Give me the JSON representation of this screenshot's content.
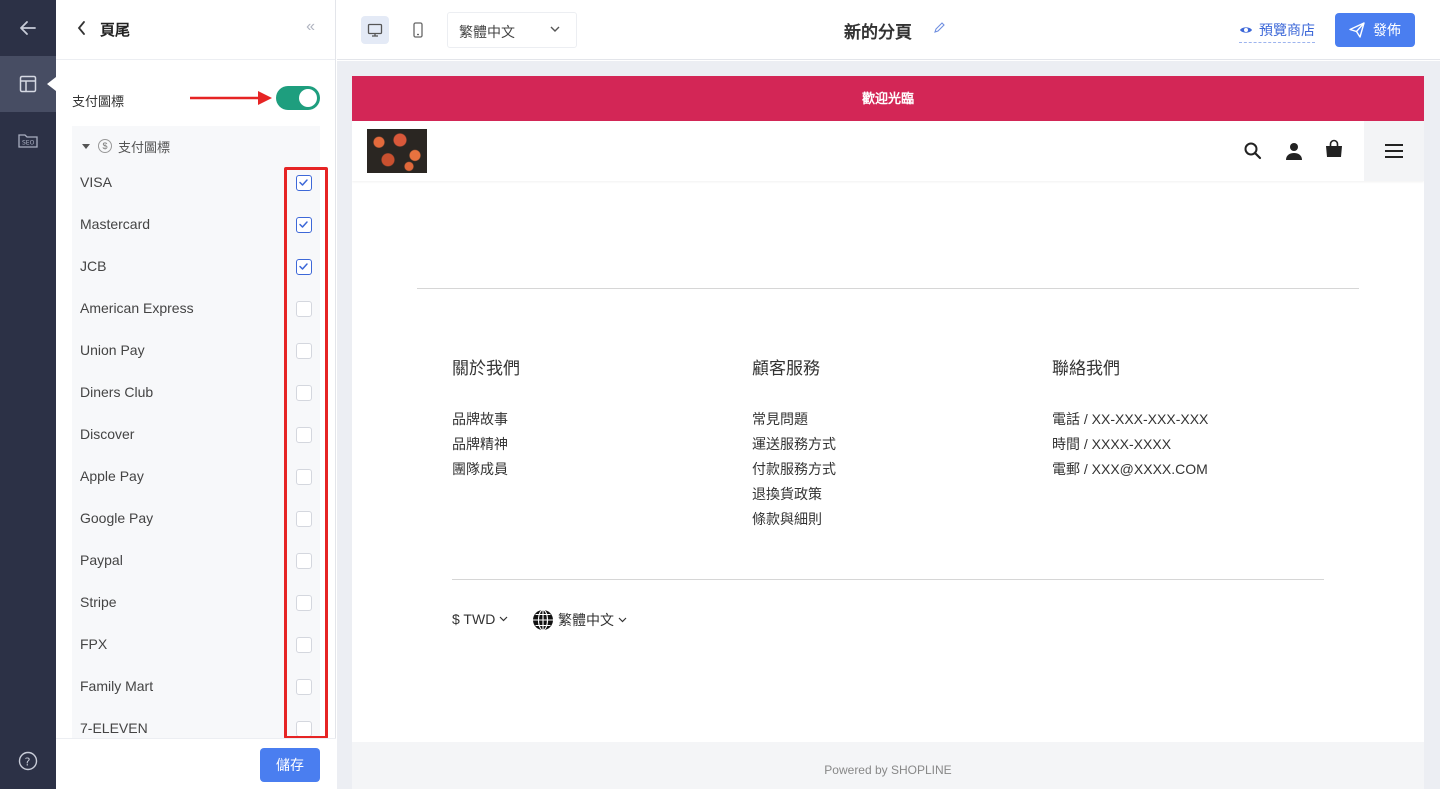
{
  "panel": {
    "title": "頁尾",
    "toggle_label": "支付圖標",
    "toggle_on": true,
    "group_label": "支付圖標",
    "save_label": "儲存",
    "payments": [
      {
        "name": "VISA",
        "checked": true
      },
      {
        "name": "Mastercard",
        "checked": true
      },
      {
        "name": "JCB",
        "checked": true
      },
      {
        "name": "American Express",
        "checked": false
      },
      {
        "name": "Union Pay",
        "checked": false
      },
      {
        "name": "Diners Club",
        "checked": false
      },
      {
        "name": "Discover",
        "checked": false
      },
      {
        "name": "Apple Pay",
        "checked": false
      },
      {
        "name": "Google Pay",
        "checked": false
      },
      {
        "name": "Paypal",
        "checked": false
      },
      {
        "name": "Stripe",
        "checked": false
      },
      {
        "name": "FPX",
        "checked": false
      },
      {
        "name": "Family Mart",
        "checked": false
      },
      {
        "name": "7-ELEVEN",
        "checked": false
      }
    ]
  },
  "topbar": {
    "language": "繁體中文",
    "page_title": "新的分頁",
    "preview_label": "預覽商店",
    "publish_label": "發佈"
  },
  "store": {
    "announcement": "歡迎光臨",
    "footer": {
      "columns": [
        {
          "title": "關於我們",
          "items": [
            "品牌故事",
            "品牌精神",
            "團隊成員"
          ]
        },
        {
          "title": "顧客服務",
          "items": [
            "常見問題",
            "運送服務方式",
            "付款服務方式",
            "退換貨政策",
            "條款與細則"
          ]
        },
        {
          "title": "聯絡我們",
          "items": [
            "電話 / XX-XXX-XXX-XXX",
            "時間 / XXXX-XXXX",
            "電郵 / XXX@XXXX.COM"
          ]
        }
      ],
      "currency": "$ TWD",
      "language": "繁體中文",
      "powered_by": "Powered by SHOPLINE"
    }
  },
  "colors": {
    "rail": "#2c3146",
    "accent": "#4a7ef0",
    "toggle": "#1e9e7e",
    "announcement": "#d32656",
    "highlight_box": "#e62424"
  }
}
